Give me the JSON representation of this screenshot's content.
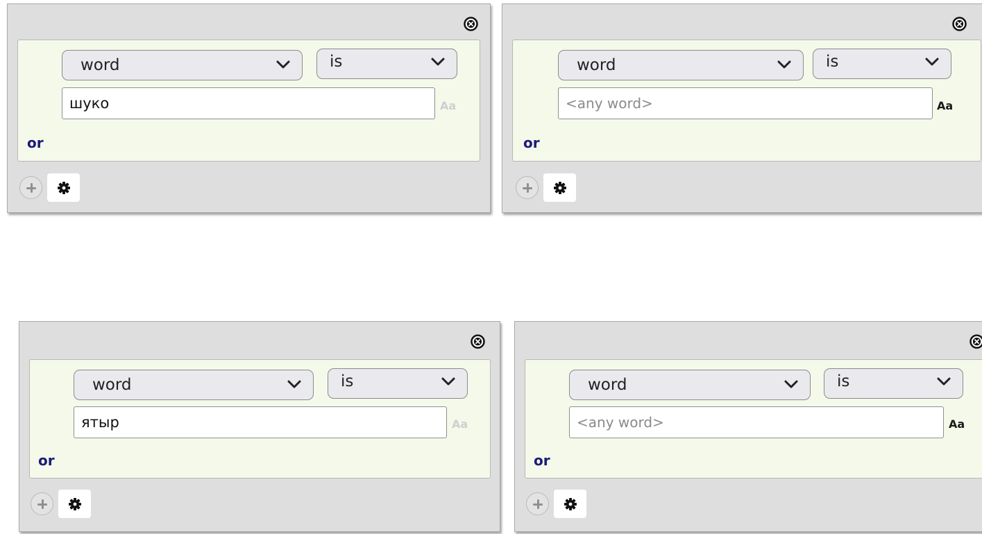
{
  "blocks": [
    {
      "attribute": "word",
      "operator": "is",
      "value": "шуко",
      "placeholder": "<any word>",
      "case_label": "Aa",
      "or_label": "or"
    },
    {
      "attribute": "word",
      "operator": "is",
      "value": "",
      "placeholder": "<any word>",
      "case_label": "Aa",
      "or_label": "or"
    },
    {
      "attribute": "word",
      "operator": "is",
      "value": "ятыр",
      "placeholder": "<any word>",
      "case_label": "Aa",
      "or_label": "or"
    },
    {
      "attribute": "word",
      "operator": "is",
      "value": "",
      "placeholder": "<any word>",
      "case_label": "Aa",
      "or_label": "or"
    }
  ],
  "icons": {
    "close": "close-circle-icon",
    "add": "plus-circle-icon",
    "settings": "gear-icon",
    "dropdown": "chevron-down-icon"
  },
  "colors": {
    "block_bg": "#dedede",
    "token_bg": "#f4f9ea",
    "or_text": "#1b1b78",
    "case_inactive": "#cfcfcf",
    "case_active": "#1a1a1a"
  }
}
